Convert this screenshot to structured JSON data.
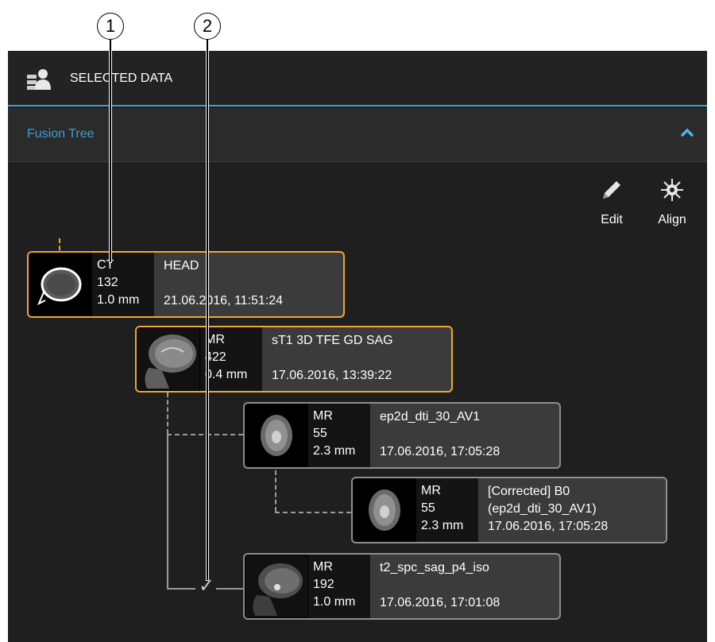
{
  "callouts": [
    "1",
    "2"
  ],
  "header": {
    "title": "SELECTED DATA",
    "icon": "selected-data-icon"
  },
  "section": {
    "label": "Fusion Tree",
    "icon": "chevron-up-icon"
  },
  "toolbar": {
    "edit_label": "Edit",
    "edit_icon": "pencil-icon",
    "align_label": "Align",
    "align_icon": "align-crosshair-icon"
  },
  "nodes": [
    {
      "modality": "CT",
      "count": "132",
      "thickness": "1.0 mm",
      "name": "HEAD",
      "name2": "",
      "date": "21.06.2016, 11:51:24",
      "selected": true
    },
    {
      "modality": "MR",
      "count": "422",
      "thickness": "0.4 mm",
      "name": "sT1 3D TFE GD SAG",
      "name2": "",
      "date": "17.06.2016, 13:39:22",
      "selected": true
    },
    {
      "modality": "MR",
      "count": "55",
      "thickness": "2.3 mm",
      "name": "ep2d_dti_30_AV1",
      "name2": "",
      "date": "17.06.2016, 17:05:28",
      "selected": false
    },
    {
      "modality": "MR",
      "count": "55",
      "thickness": "2.3 mm",
      "name": "[Corrected] B0",
      "name2": "(ep2d_dti_30_AV1)",
      "date": "17.06.2016, 17:05:28",
      "selected": false
    },
    {
      "modality": "MR",
      "count": "192",
      "thickness": "1.0 mm",
      "name": "t2_spc_sag_p4_iso",
      "name2": "",
      "date": "17.06.2016, 17:01:08",
      "selected": false
    }
  ],
  "colors": {
    "accent_blue": "#3aa0d8",
    "selected_orange": "#f0a830",
    "panel": "#1f1f1f"
  }
}
